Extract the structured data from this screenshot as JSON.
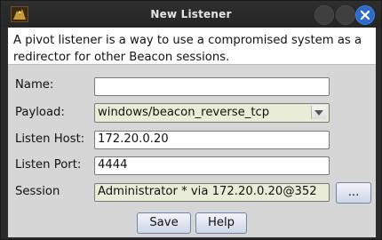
{
  "window": {
    "title": "New Listener"
  },
  "description": "A pivot listener is a way to use a compromised system as a redirector for other Beacon sessions.",
  "form": {
    "name": {
      "label": "Name:",
      "value": ""
    },
    "payload": {
      "label": "Payload:",
      "value": "windows/beacon_reverse_tcp"
    },
    "listen_host": {
      "label": "Listen Host:",
      "value": "172.20.0.20"
    },
    "listen_port": {
      "label": "Listen Port:",
      "value": "4444"
    },
    "session": {
      "label": "Session",
      "value": "Administrator * via  172.20.0.20@352",
      "browse_label": "..."
    }
  },
  "buttons": {
    "save": "Save",
    "help": "Help"
  },
  "colors": {
    "close_button": "#2e6cc9",
    "readonly_field": "#e9ecd7"
  },
  "icons": [
    "app-icon",
    "minimize-icon",
    "maximize-icon",
    "close-icon",
    "dropdown-arrow-icon"
  ]
}
